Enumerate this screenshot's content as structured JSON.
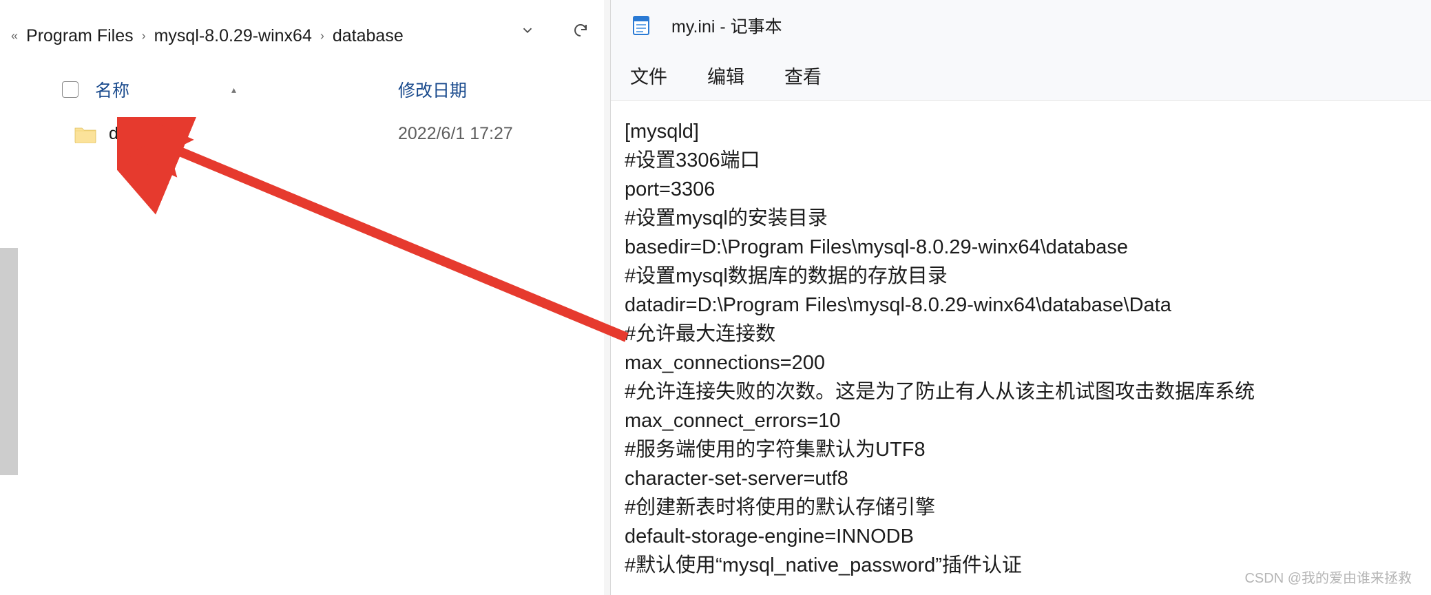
{
  "explorer": {
    "breadcrumbs": [
      "Program Files",
      "mysql-8.0.29-winx64",
      "database"
    ],
    "columns": {
      "name": "名称",
      "modified": "修改日期"
    },
    "rows": [
      {
        "name": "data",
        "modified": "2022/6/1 17:27"
      }
    ]
  },
  "notepad": {
    "title": "my.ini - 记事本",
    "menus": {
      "file": "文件",
      "edit": "编辑",
      "view": "查看"
    },
    "lines": [
      "[mysqld]",
      "#设置3306端口",
      "port=3306",
      "#设置mysql的安装目录",
      "basedir=D:\\Program Files\\mysql-8.0.29-winx64\\database",
      "#设置mysql数据库的数据的存放目录",
      "datadir=D:\\Program Files\\mysql-8.0.29-winx64\\database\\Data",
      "#允许最大连接数",
      "max_connections=200",
      "#允许连接失败的次数。这是为了防止有人从该主机试图攻击数据库系统",
      "max_connect_errors=10",
      "#服务端使用的字符集默认为UTF8",
      "character-set-server=utf8",
      "#创建新表时将使用的默认存储引擎",
      "default-storage-engine=INNODB",
      "#默认使用“mysql_native_password”插件认证"
    ]
  },
  "watermark": "CSDN @我的爱由谁来拯救"
}
